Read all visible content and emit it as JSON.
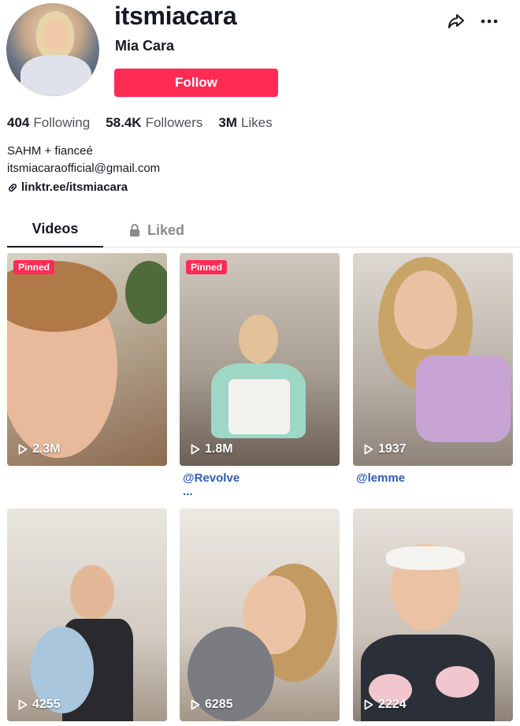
{
  "profile": {
    "username": "itsmiacara",
    "display_name": "Mia Cara",
    "follow_label": "Follow"
  },
  "stats": {
    "following_count": "404",
    "following_label": "Following",
    "followers_count": "58.4K",
    "followers_label": "Followers",
    "likes_count": "3M",
    "likes_label": "Likes"
  },
  "bio": {
    "line1": "SAHM + fianceé",
    "line2": "itsmiacaraofficial@gmail.com",
    "link": "linktr.ee/itsmiacara"
  },
  "tabs": {
    "videos": "Videos",
    "liked": "Liked"
  },
  "pinned_label": "Pinned",
  "videos": [
    {
      "views": "2.3M",
      "pinned": true
    },
    {
      "views": "1.8M",
      "pinned": true,
      "caption": "@Revolve ..."
    },
    {
      "views": "1937",
      "pinned": false,
      "caption": "@lemme"
    },
    {
      "views": "4255",
      "pinned": false
    },
    {
      "views": "6285",
      "pinned": false
    },
    {
      "views": "2224",
      "pinned": false
    }
  ],
  "colors": {
    "accent": "#fe2c55",
    "text": "#161823",
    "muted": "#8a8b91",
    "caption_link": "#2f5db2"
  },
  "icons": [
    "share-icon",
    "more-icon",
    "link-icon",
    "lock-icon",
    "play-icon"
  ]
}
